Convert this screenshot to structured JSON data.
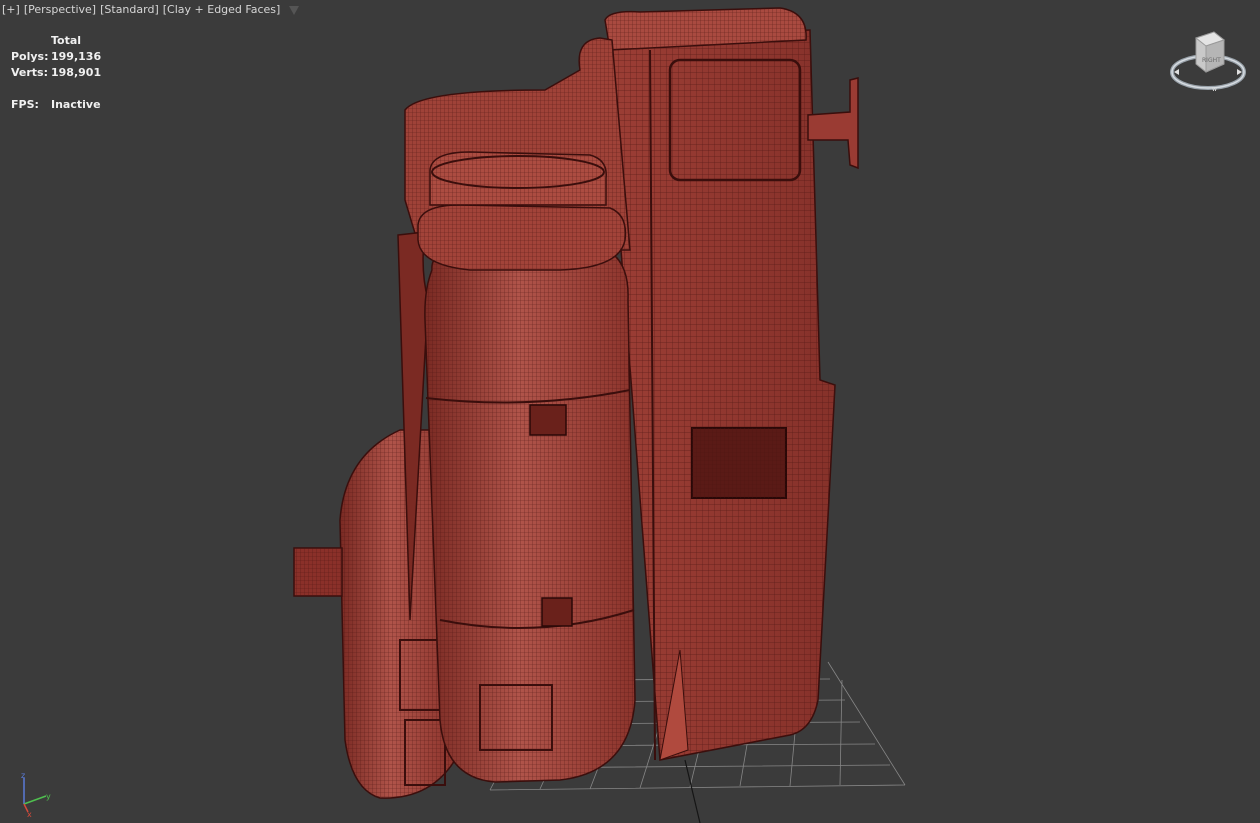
{
  "viewport": {
    "label_plus": "[+]",
    "label_view": "[Perspective]",
    "label_shading": "[Standard]",
    "label_mode": "[Clay + Edged Faces]"
  },
  "stats": {
    "header": "Total",
    "polys_label": "Polys:",
    "polys_value": "199,136",
    "verts_label": "Verts:",
    "verts_value": "198,901",
    "fps_label": "FPS:",
    "fps_value": "Inactive"
  },
  "viewcube": {
    "face_label": "RIGHT"
  },
  "axis": {
    "x": "x",
    "y": "y",
    "z": "z"
  },
  "colors": {
    "background": "#3b3b3b",
    "mesh": "#a8463a",
    "mesh_dark": "#5e1a16",
    "grid": "#9a9a9a"
  }
}
